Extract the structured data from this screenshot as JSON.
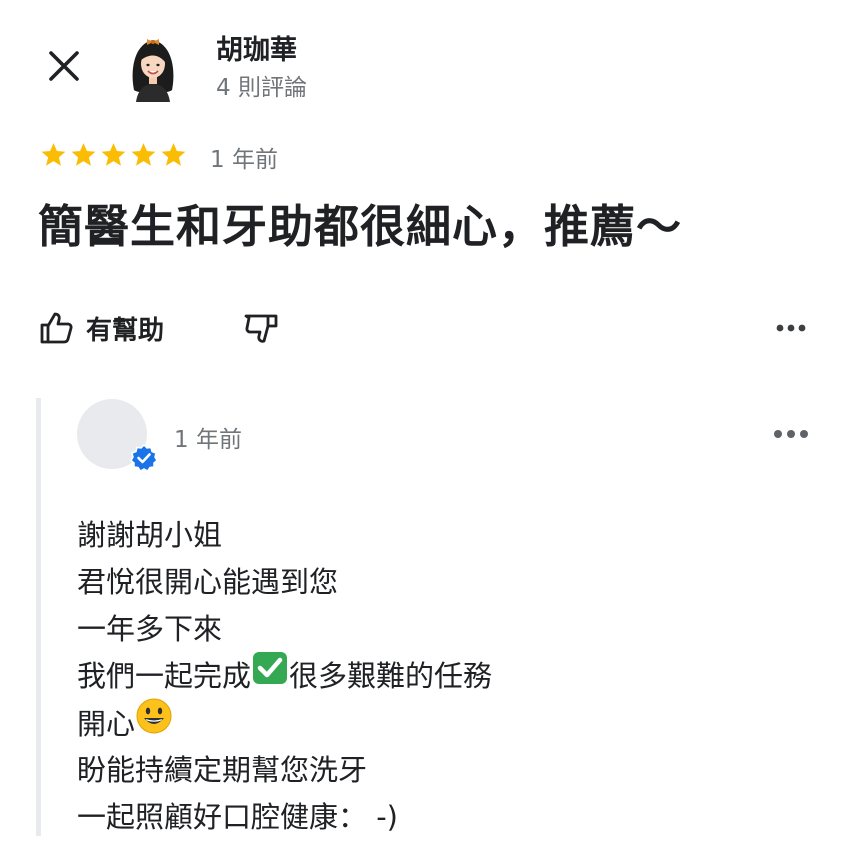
{
  "header": {
    "reviewer_name": "胡珈華",
    "review_count": "4 則評論"
  },
  "review": {
    "rating": 5,
    "max_rating": 5,
    "time": "1 年前",
    "text": "簡醫生和牙助都很細心，推薦～",
    "helpful_label": "有幫助"
  },
  "reply": {
    "time": "1 年前",
    "lines": [
      "謝謝胡小姐",
      "君悅很開心能遇到您",
      "一年多下來"
    ],
    "line4_before": "我們一起完成",
    "line4_after": "很多艱難的任務",
    "line5_before": "開心",
    "line6": "盼能持續定期幫您洗牙",
    "line7": "一起照顧好口腔健康： -)"
  },
  "colors": {
    "star": "#fbbc04",
    "secondary_text": "#70757a",
    "verified": "#1a73e8",
    "check_emoji": "#34a853"
  },
  "icons": {
    "close": "close-icon",
    "thumb_up": "thumbs-up-icon",
    "thumb_down": "thumbs-down-icon",
    "more": "more-horizontal-icon",
    "verified": "verified-badge-icon",
    "check": "check-mark-emoji",
    "smile": "smiling-face-emoji"
  }
}
